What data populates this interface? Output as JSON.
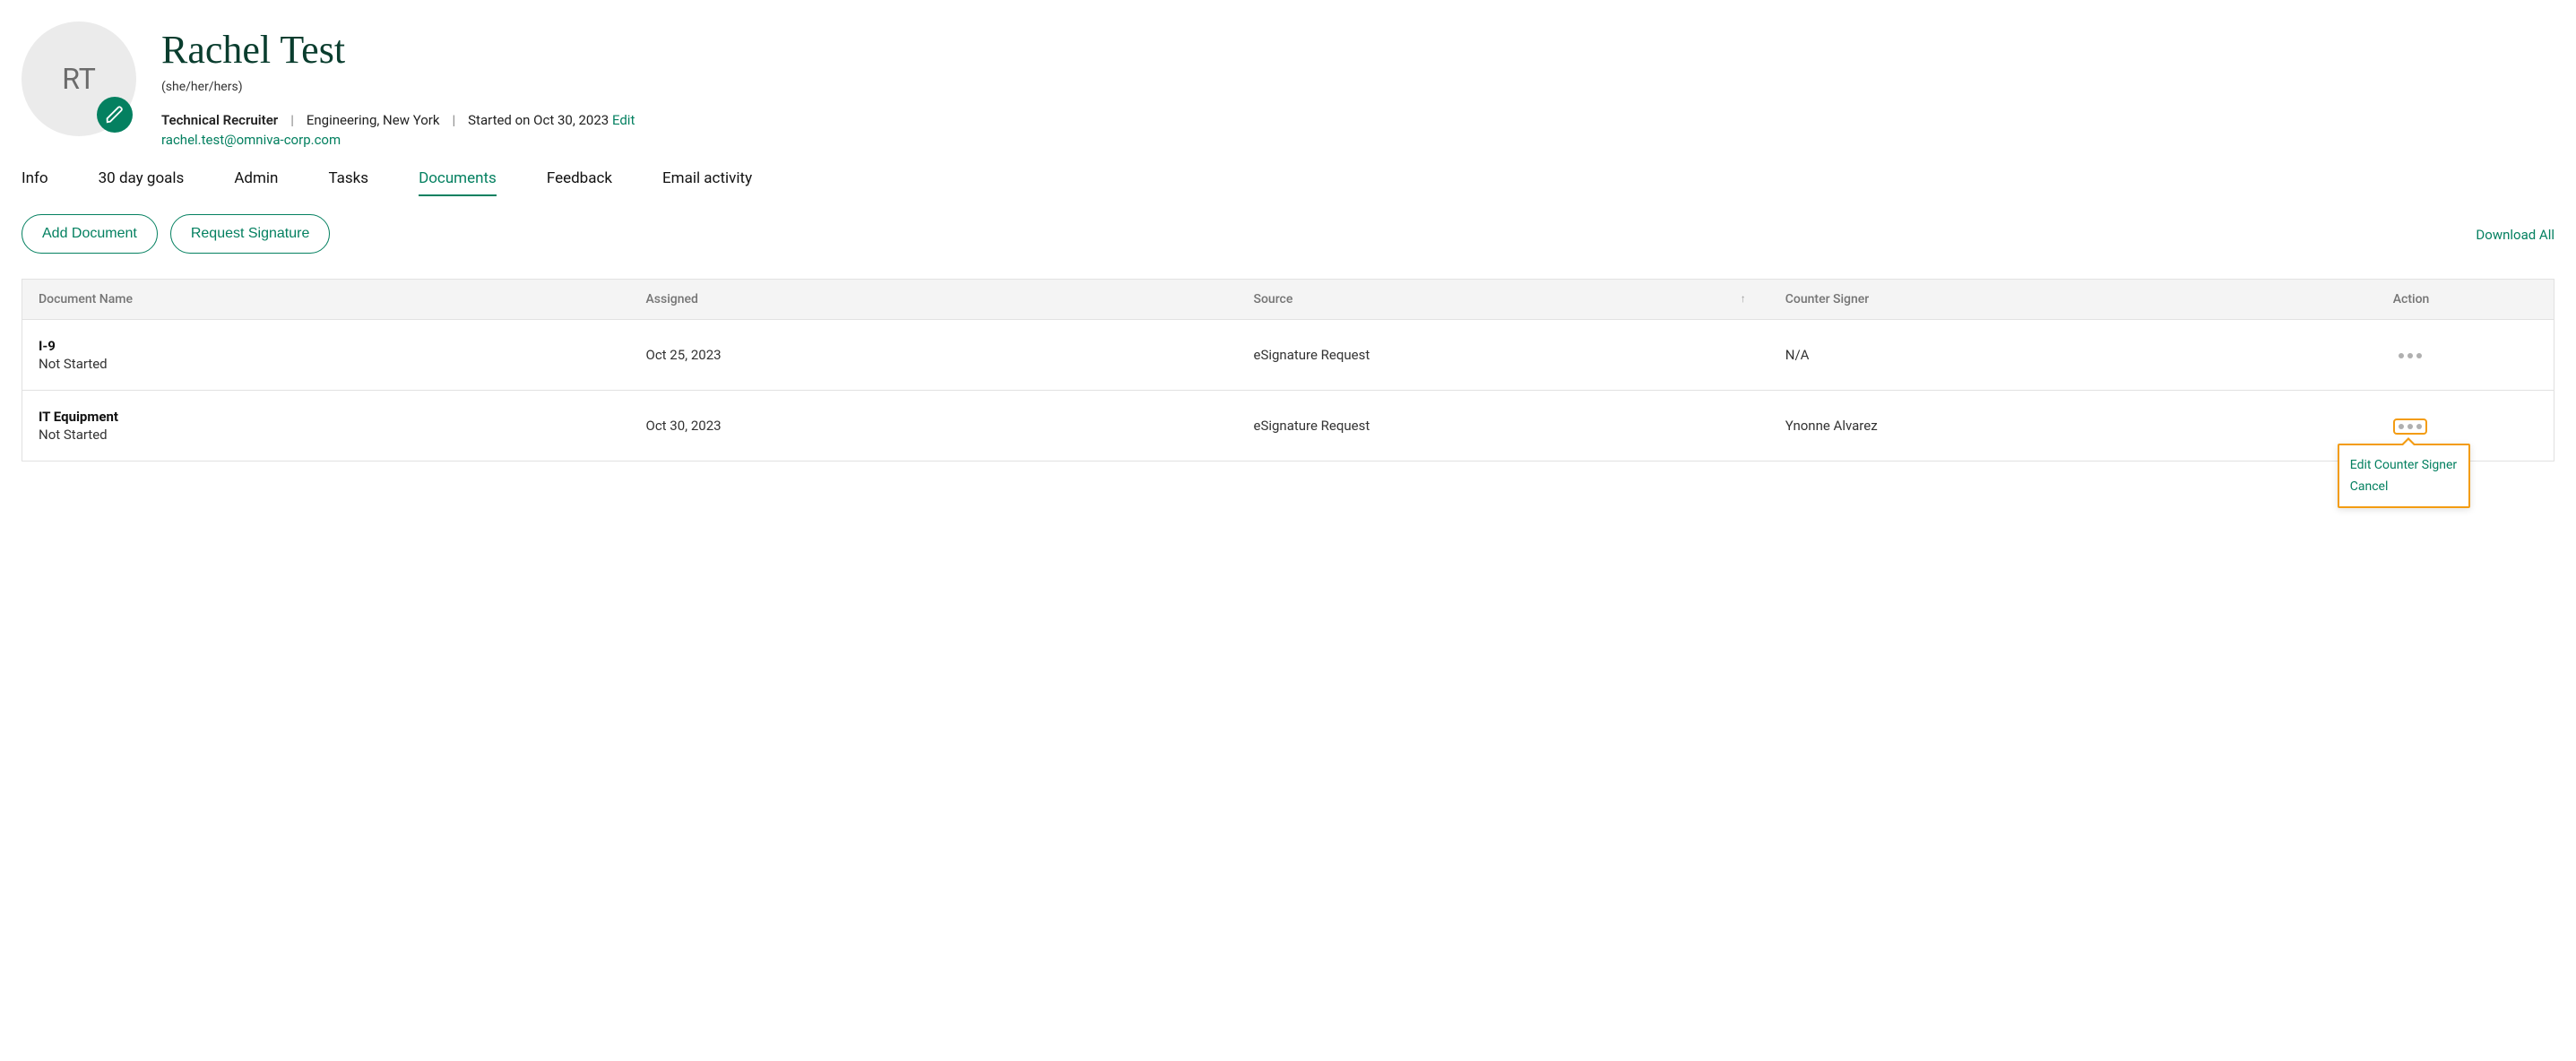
{
  "person": {
    "initials": "RT",
    "name": "Rachel Test",
    "pronouns": "(she/her/hers)",
    "title": "Technical Recruiter",
    "department_location": "Engineering, New York",
    "start_text": "Started on Oct 30, 2023",
    "edit_label": "Edit",
    "email": "rachel.test@omniva-corp.com"
  },
  "tabs": {
    "info": "Info",
    "goals": "30 day goals",
    "admin": "Admin",
    "tasks": "Tasks",
    "documents": "Documents",
    "feedback": "Feedback",
    "email_activity": "Email activity"
  },
  "toolbar": {
    "add_document": "Add Document",
    "request_signature": "Request Signature",
    "download_all": "Download All"
  },
  "table": {
    "headers": {
      "name": "Document Name",
      "assigned": "Assigned",
      "source": "Source",
      "signer": "Counter Signer",
      "action": "Action"
    },
    "sort_indicator": "↑",
    "rows": [
      {
        "name": "I-9",
        "status": "Not Started",
        "assigned": "Oct 25, 2023",
        "source": "eSignature Request",
        "signer": "N/A"
      },
      {
        "name": "IT Equipment",
        "status": "Not Started",
        "assigned": "Oct 30, 2023",
        "source": "eSignature Request",
        "signer": "Ynonne Alvarez"
      }
    ]
  },
  "popover": {
    "edit_signer": "Edit Counter Signer",
    "cancel": "Cancel"
  }
}
